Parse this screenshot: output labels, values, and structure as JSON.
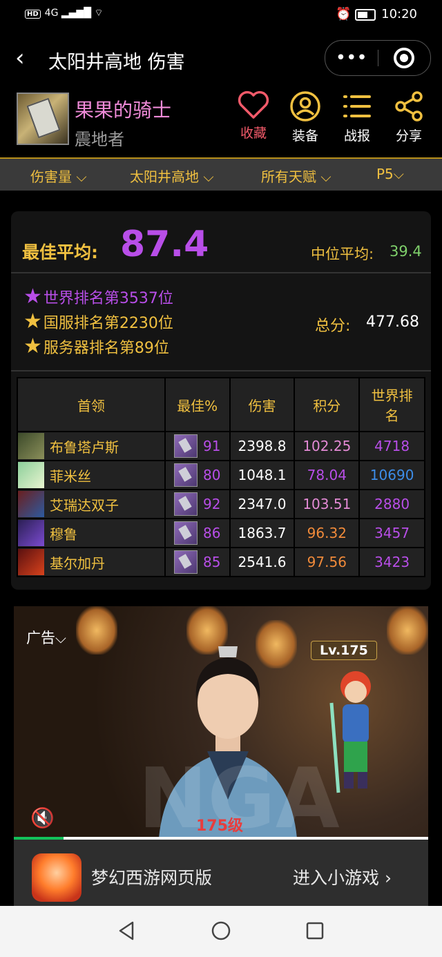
{
  "status_bar": {
    "network": "4G",
    "hd": "HD",
    "time": "10:20"
  },
  "header": {
    "back_icon": "‹",
    "title": "太阳井高地 伤害",
    "more_icon": "•••"
  },
  "profile": {
    "name": "果果的骑士",
    "spec": "震地者"
  },
  "actions": [
    {
      "label": "收藏",
      "color": "#f25a6a",
      "icon": "heart-icon"
    },
    {
      "label": "装备",
      "color": "#f0c040",
      "icon": "user-circle-icon"
    },
    {
      "label": "战报",
      "color": "#f0c040",
      "icon": "list-icon"
    },
    {
      "label": "分享",
      "color": "#f0c040",
      "icon": "share-icon"
    }
  ],
  "filters": [
    "伤害量",
    "太阳井高地",
    "所有天赋",
    "P5"
  ],
  "stats": {
    "best_avg_label": "最佳平均:",
    "best_avg_value": "87.4",
    "median_label": "中位平均:",
    "median_value": "39.4",
    "ranks": [
      {
        "text": "世界排名第3537位",
        "color": "#b84ee8"
      },
      {
        "text": "国服排名第2230位",
        "color": "#f0c040"
      },
      {
        "text": "服务器排名第89位",
        "color": "#f0c040"
      }
    ],
    "total_label": "总分:",
    "total_value": "477.68"
  },
  "table": {
    "headers": [
      "首领",
      "最佳%",
      "伤害",
      "积分",
      "世界排名"
    ],
    "rows": [
      {
        "boss": "布鲁塔卢斯",
        "pct": "91",
        "damage": "2398.8",
        "score": "102.25",
        "score_color": "#e38ad5",
        "rank": "4718",
        "rank_color": "#b84ee8"
      },
      {
        "boss": "菲米丝",
        "pct": "80",
        "damage": "1048.1",
        "score": "78.04",
        "score_color": "#b84ee8",
        "rank": "10690",
        "rank_color": "#3d8de8"
      },
      {
        "boss": "艾瑞达双子",
        "pct": "92",
        "damage": "2347.0",
        "score": "103.51",
        "score_color": "#e38ad5",
        "rank": "2880",
        "rank_color": "#b84ee8"
      },
      {
        "boss": "穆鲁",
        "pct": "86",
        "damage": "1863.7",
        "score": "96.32",
        "score_color": "#f08a3a",
        "rank": "3457",
        "rank_color": "#b84ee8"
      },
      {
        "boss": "基尔加丹",
        "pct": "85",
        "damage": "2541.6",
        "score": "97.56",
        "score_color": "#f08a3a",
        "rank": "3423",
        "rank_color": "#b84ee8"
      }
    ]
  },
  "ad": {
    "tag": "广告",
    "level_badge": "Lv.175",
    "level_text": "175级",
    "watermark": "NGA",
    "progress": 0.12,
    "game_name": "梦幻西游网页版",
    "enter_label": "进入小游戏 ›"
  }
}
